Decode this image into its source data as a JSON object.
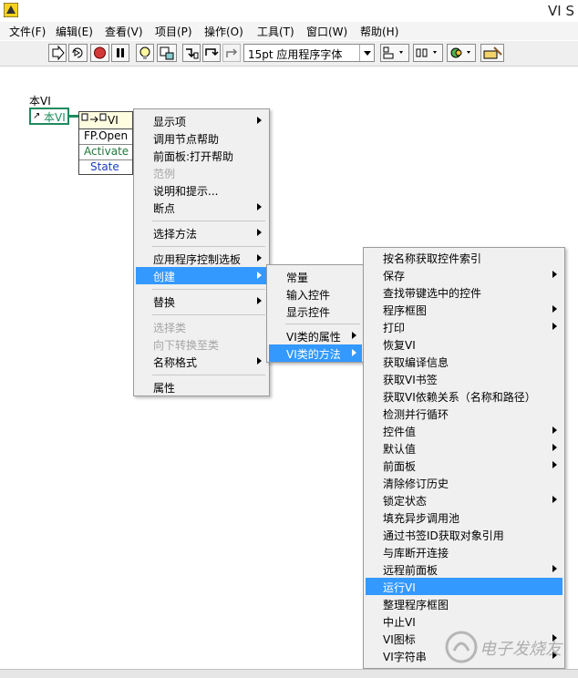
{
  "window": {
    "title": "VI S"
  },
  "menubar": [
    {
      "label": "文件(F)"
    },
    {
      "label": "编辑(E)"
    },
    {
      "label": "查看(V)"
    },
    {
      "label": "项目(P)"
    },
    {
      "label": "操作(O)"
    },
    {
      "label": "工具(T)"
    },
    {
      "label": "窗口(W)"
    },
    {
      "label": "帮助(H)"
    }
  ],
  "toolbar": {
    "font_selector_value": "15pt 应用程序字体",
    "buttons": [
      "run-arrow-icon",
      "run-continuously-icon",
      "abort-icon",
      "pause-icon",
      "highlight-execution-icon",
      "retain-wire-values-icon",
      "step-into-icon",
      "step-over-icon",
      "step-out-icon",
      "align-objects-icon",
      "distribute-objects-icon",
      "reorder-icon",
      "cleanup-diagram-icon"
    ]
  },
  "diagram": {
    "this_vi_label": "本VI",
    "reference_terminal": "本VI",
    "invoke_node": {
      "title": "VI",
      "method": "FP.Open",
      "param1": "Activate",
      "param2": "State"
    }
  },
  "menu1": {
    "items": [
      {
        "label": "显示项",
        "sub": true
      },
      {
        "label": "调用节点帮助"
      },
      {
        "label": "前面板:打开帮助"
      },
      {
        "label": "范例",
        "disabled": true
      },
      {
        "label": "说明和提示..."
      },
      {
        "label": "断点",
        "sub": true
      },
      {
        "label": "选择方法",
        "sub": true
      },
      {
        "label": "应用程序控制选板",
        "sub": true
      },
      {
        "label": "创建",
        "sub": true,
        "selected": true
      },
      {
        "label": "替换",
        "sub": true
      },
      {
        "label": "选择类",
        "disabled": true
      },
      {
        "label": "向下转换至类",
        "disabled": true
      },
      {
        "label": "名称格式",
        "sub": true
      },
      {
        "label": "属性"
      }
    ]
  },
  "menu2": {
    "items": [
      {
        "label": "常量"
      },
      {
        "label": "输入控件"
      },
      {
        "label": "显示控件"
      },
      {
        "label": "VI类的属性",
        "sub": true
      },
      {
        "label": "VI类的方法",
        "sub": true,
        "selected": true
      }
    ]
  },
  "menu3": {
    "items": [
      {
        "label": "按名称获取控件索引"
      },
      {
        "label": "保存",
        "sub": true
      },
      {
        "label": "查找带键选中的控件"
      },
      {
        "label": "程序框图",
        "sub": true
      },
      {
        "label": "打印",
        "sub": true
      },
      {
        "label": "恢复VI"
      },
      {
        "label": "获取编译信息"
      },
      {
        "label": "获取VI书签"
      },
      {
        "label": "获取VI依赖关系（名称和路径）"
      },
      {
        "label": "检测并行循环"
      },
      {
        "label": "控件值",
        "sub": true
      },
      {
        "label": "默认值",
        "sub": true
      },
      {
        "label": "前面板",
        "sub": true
      },
      {
        "label": "清除修订历史"
      },
      {
        "label": "锁定状态",
        "sub": true
      },
      {
        "label": "填充异步调用池"
      },
      {
        "label": "通过书签ID获取对象引用"
      },
      {
        "label": "与库断开连接"
      },
      {
        "label": "远程前面板",
        "sub": true
      },
      {
        "label": "运行VI",
        "selected": true
      },
      {
        "label": "整理程序框图"
      },
      {
        "label": "中止VI"
      },
      {
        "label": "VI图标",
        "sub": true
      },
      {
        "label": "VI字符串",
        "sub": true
      }
    ]
  },
  "watermark": {
    "text": "电子发烧友"
  }
}
